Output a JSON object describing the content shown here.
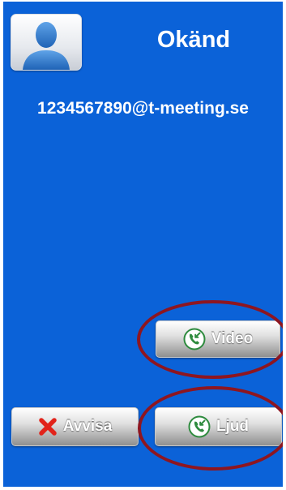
{
  "call": {
    "caller_name": "Okänd",
    "caller_address": "1234567890@t-meeting.se"
  },
  "actions": {
    "video_label": "Video",
    "reject_label": "Avvisa",
    "audio_label": "Ljud"
  },
  "icons": {
    "avatar": "person-silhouette-icon",
    "video": "answer-call-icon",
    "reject": "red-x-icon",
    "audio": "answer-call-icon"
  },
  "colors": {
    "background": "#0b62d8",
    "reject_x": "#e2231a",
    "answer_icon_bg": "#2e8b3e",
    "highlight_ring": "#8e1620"
  }
}
